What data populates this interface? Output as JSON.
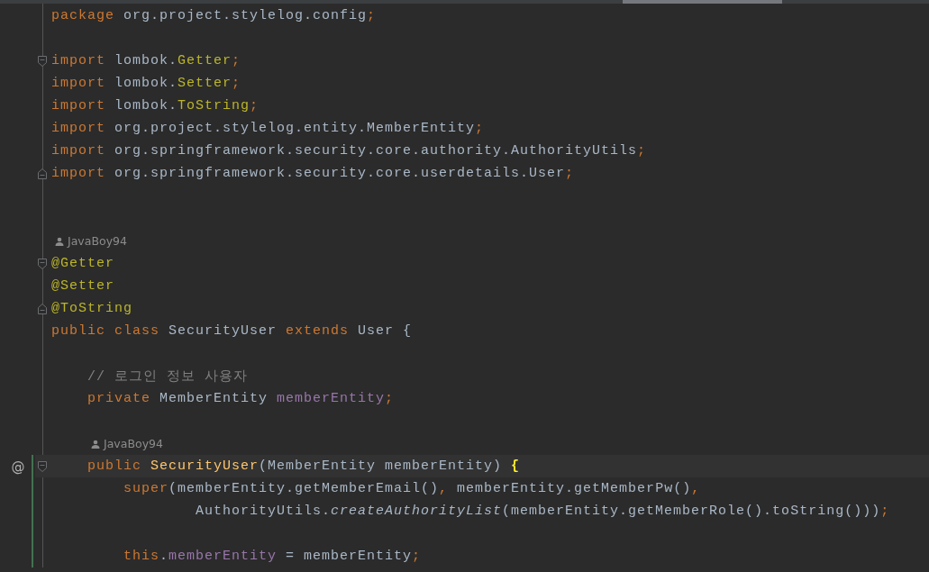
{
  "editor": {
    "lines": [
      {
        "kind": "code",
        "tokens": [
          {
            "kind": "keyword",
            "text": "package "
          },
          {
            "kind": "plain",
            "text": "org.project.stylelog.config"
          },
          {
            "kind": "keyword",
            "text": ";"
          }
        ]
      },
      {
        "kind": "blank"
      },
      {
        "kind": "code",
        "fold_start": true,
        "tokens": [
          {
            "kind": "keyword",
            "text": "import "
          },
          {
            "kind": "plain",
            "text": "lombok."
          },
          {
            "kind": "annotation",
            "text": "Getter"
          },
          {
            "kind": "keyword",
            "text": ";"
          }
        ]
      },
      {
        "kind": "code",
        "tokens": [
          {
            "kind": "keyword",
            "text": "import "
          },
          {
            "kind": "plain",
            "text": "lombok."
          },
          {
            "kind": "annotation",
            "text": "Setter"
          },
          {
            "kind": "keyword",
            "text": ";"
          }
        ]
      },
      {
        "kind": "code",
        "tokens": [
          {
            "kind": "keyword",
            "text": "import "
          },
          {
            "kind": "plain",
            "text": "lombok."
          },
          {
            "kind": "annotation",
            "text": "ToString"
          },
          {
            "kind": "keyword",
            "text": ";"
          }
        ]
      },
      {
        "kind": "code",
        "tokens": [
          {
            "kind": "keyword",
            "text": "import "
          },
          {
            "kind": "plain",
            "text": "org.project.stylelog.entity.MemberEntity"
          },
          {
            "kind": "keyword",
            "text": ";"
          }
        ]
      },
      {
        "kind": "code",
        "tokens": [
          {
            "kind": "keyword",
            "text": "import "
          },
          {
            "kind": "plain",
            "text": "org.springframework.security.core.authority.AuthorityUtils"
          },
          {
            "kind": "keyword",
            "text": ";"
          }
        ]
      },
      {
        "kind": "code",
        "fold_end": true,
        "tokens": [
          {
            "kind": "keyword",
            "text": "import "
          },
          {
            "kind": "plain",
            "text": "org.springframework.security.core.userdetails.User"
          },
          {
            "kind": "keyword",
            "text": ";"
          }
        ]
      },
      {
        "kind": "blank"
      },
      {
        "kind": "blank"
      },
      {
        "kind": "author",
        "author": "JavaBoy94"
      },
      {
        "kind": "code",
        "fold_start": true,
        "tokens": [
          {
            "kind": "annotation",
            "text": "@Getter"
          }
        ]
      },
      {
        "kind": "code",
        "tokens": [
          {
            "kind": "annotation",
            "text": "@Setter"
          }
        ]
      },
      {
        "kind": "code",
        "fold_end": true,
        "tokens": [
          {
            "kind": "annotation",
            "text": "@ToString"
          }
        ]
      },
      {
        "kind": "code",
        "tokens": [
          {
            "kind": "keyword",
            "text": "public class "
          },
          {
            "kind": "plain",
            "text": "SecurityUser "
          },
          {
            "kind": "keyword",
            "text": "extends "
          },
          {
            "kind": "plain",
            "text": "User {"
          }
        ]
      },
      {
        "kind": "blank"
      },
      {
        "kind": "code",
        "tokens": [
          {
            "kind": "comment",
            "text": "    // 로그인 정보 사용자"
          }
        ]
      },
      {
        "kind": "code",
        "tokens": [
          {
            "kind": "keyword",
            "text": "    private "
          },
          {
            "kind": "plain",
            "text": "MemberEntity "
          },
          {
            "kind": "field",
            "text": "memberEntity"
          },
          {
            "kind": "keyword",
            "text": ";"
          }
        ]
      },
      {
        "kind": "blank"
      },
      {
        "kind": "author",
        "author": "JavaBoy94"
      },
      {
        "kind": "code",
        "fold_start": true,
        "gutter_mark": "@",
        "current": true,
        "changed": true,
        "tokens": [
          {
            "kind": "keyword",
            "text": "    public "
          },
          {
            "kind": "method",
            "text": "SecurityUser"
          },
          {
            "kind": "plain",
            "text": "(MemberEntity memberEntity) "
          },
          {
            "kind": "brace",
            "text": "{"
          }
        ]
      },
      {
        "kind": "code",
        "changed": true,
        "tokens": [
          {
            "kind": "keyword",
            "text": "        super"
          },
          {
            "kind": "plain",
            "text": "(memberEntity.getMemberEmail()"
          },
          {
            "kind": "keyword",
            "text": ", "
          },
          {
            "kind": "plain",
            "text": "memberEntity.getMemberPw()"
          },
          {
            "kind": "keyword",
            "text": ","
          }
        ]
      },
      {
        "kind": "code",
        "changed": true,
        "tokens": [
          {
            "kind": "plain",
            "text": "                AuthorityUtils."
          },
          {
            "kind": "static",
            "text": "createAuthorityList"
          },
          {
            "kind": "plain",
            "text": "(memberEntity.getMemberRole().toString()))"
          },
          {
            "kind": "keyword",
            "text": ";"
          }
        ]
      },
      {
        "kind": "blank",
        "changed": true
      },
      {
        "kind": "code",
        "changed": true,
        "tokens": [
          {
            "kind": "keyword",
            "text": "        this"
          },
          {
            "kind": "plain",
            "text": "."
          },
          {
            "kind": "field",
            "text": "memberEntity"
          },
          {
            "kind": "plain",
            "text": " = memberEntity"
          },
          {
            "kind": "keyword",
            "text": ";"
          }
        ]
      }
    ]
  }
}
